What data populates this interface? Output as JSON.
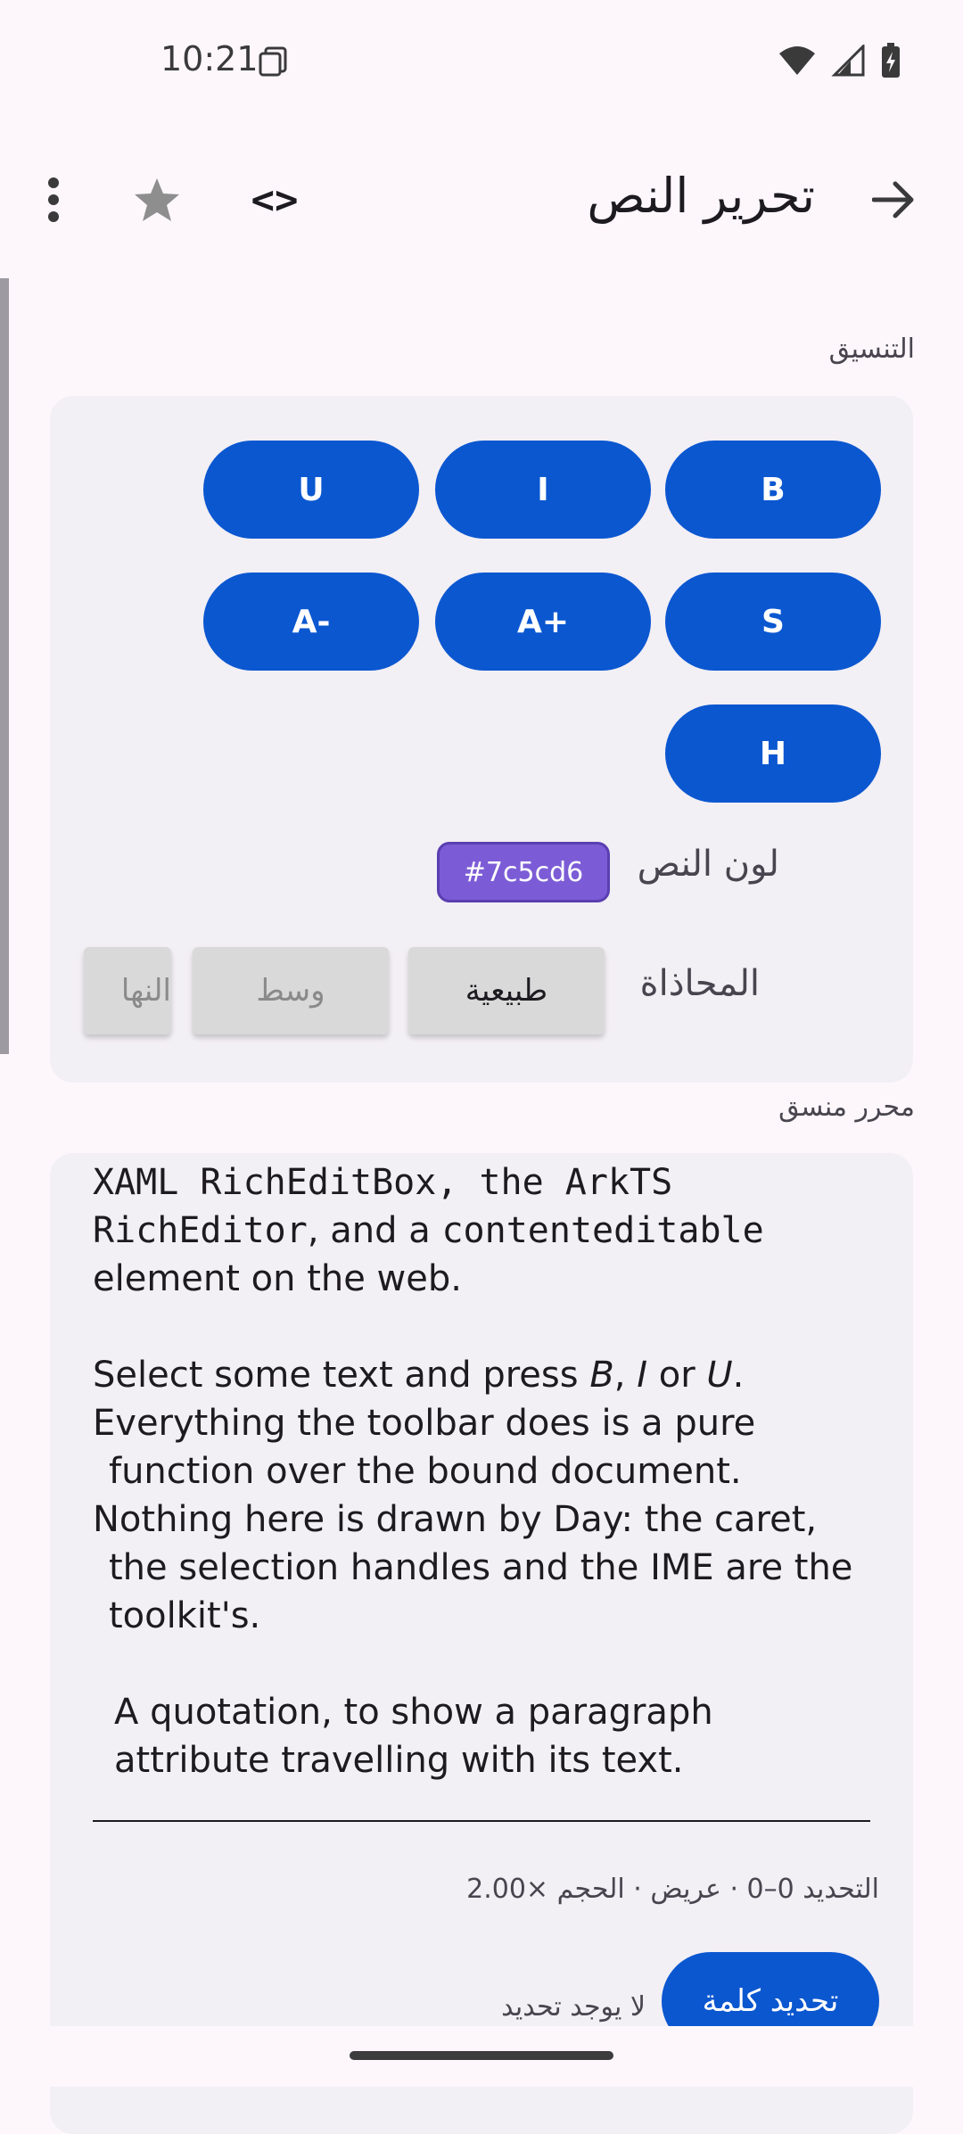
{
  "status": {
    "time": "10:21"
  },
  "app_bar": {
    "title": "تحرير النص",
    "code_label": "<>"
  },
  "sections": {
    "formatting": "التنسيق",
    "editor": "محرر منسق"
  },
  "format_buttons": {
    "bold": "B",
    "italic": "I",
    "underline": "U",
    "strike": "S",
    "grow": "A+",
    "shrink": "A-",
    "highlight": "H"
  },
  "text_color": {
    "label": "لون النص",
    "value": "#7c5cd6"
  },
  "alignment": {
    "label": "المحاذاة",
    "options": [
      "طبيعية",
      "وسط",
      "النها"
    ]
  },
  "editor": {
    "line1": "XAML RichEditBox, the ArkTS",
    "line2_code": "RichEditor",
    "line2_mid": ", and a ",
    "line2_code2": "contenteditable",
    "line3": "element on the web.",
    "line4_pre": "Select some text and press ",
    "line4_b": "B",
    "line4_sep1": ", ",
    "line4_i": "I",
    "line4_sep2": " or ",
    "line4_u": "U",
    "line4_end": ".",
    "line5": "Everything the toolbar does is a pure",
    "line6": "function over the bound document.",
    "line7": "Nothing here is drawn by Day: the caret,",
    "line8": "the selection handles and the IME are the",
    "line9": "toolkit's.",
    "quote1": "A quotation, to show a paragraph",
    "quote2": "attribute travelling with its text."
  },
  "selection_info": "التحديد 0–0 · عريض · الحجم ×2.00",
  "no_selection": "لا يوجد تحديد",
  "select_word_label": "تحديد كلمة",
  "colors": {
    "primary": "#0b57d0",
    "chip": "#7c5cd6",
    "card": "#f2eff5",
    "background": "#fdf7fc"
  }
}
